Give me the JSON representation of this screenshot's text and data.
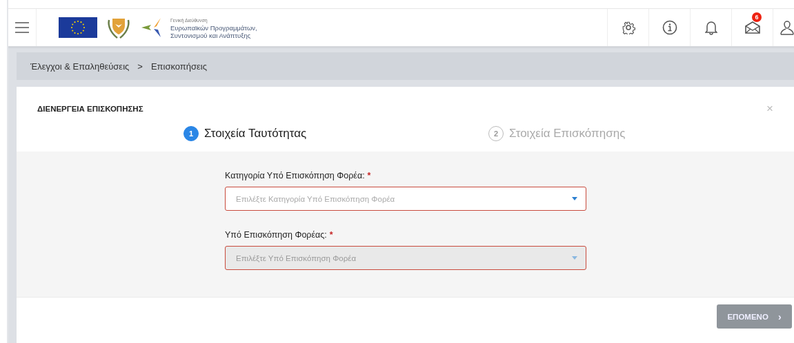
{
  "header": {
    "logo_text": [
      "Γενική Διεύθυνση",
      "Ευρωπαϊκών Προγραμμάτων,",
      "Συντονισμού και Ανάπτυξης"
    ],
    "notification_count": "6"
  },
  "breadcrumb": [
    "Έλεγχοι & Επαληθεύσεις",
    "Επισκοπήσεις"
  ],
  "breadcrumb_separator": ">",
  "dialog": {
    "title": "ΔΙΕΝΕΡΓΕΙΑ ΕΠΙΣΚΟΠΗΣΗΣ",
    "close": "×",
    "steps": [
      {
        "number": "1",
        "label": "Στοιχεία Ταυτότητας",
        "selected": true
      },
      {
        "number": "2",
        "label": "Στοιχεία Επισκόπησης",
        "selected": false
      }
    ],
    "fields": [
      {
        "label": "Κατηγορία Υπό Επισκόπηση Φορέα:",
        "required": "*",
        "placeholder": "Επιλέξτε Κατηγορία Υπό Επισκόπηση Φορέα",
        "disabled": false,
        "invalid": true
      },
      {
        "label": "Υπό Επισκόπηση Φορέας:",
        "required": "*",
        "placeholder": "Επιλέξτε Υπό Επισκόπηση Φορέα",
        "disabled": true,
        "invalid": true
      }
    ],
    "next_button": {
      "label": "ΕΠΟΜΕΝΟ",
      "icon": "›",
      "disabled": true
    }
  }
}
